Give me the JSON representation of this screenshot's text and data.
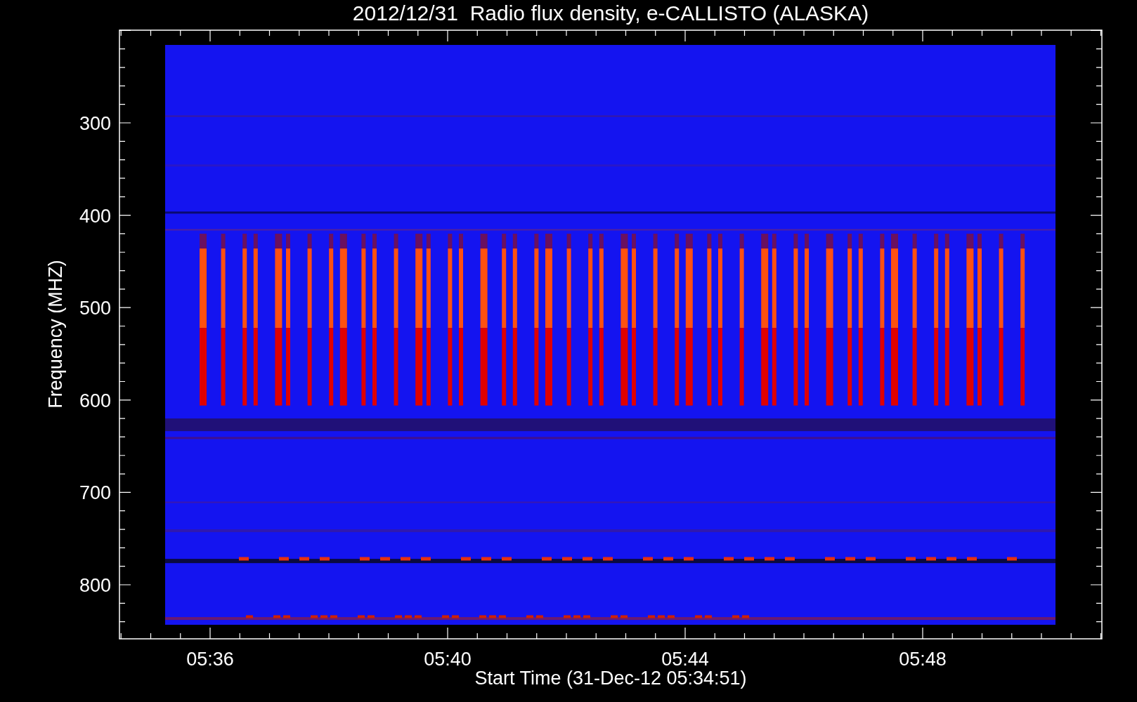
{
  "title": "2012/12/31  Radio flux density, e-CALLISTO (ALASKA)",
  "plot": {
    "ylabel": "Frequency (MHZ)",
    "xlabel": "Start Time (31-Dec-12 05:34:51)",
    "yticks": [
      "300",
      "400",
      "500",
      "600",
      "700",
      "800"
    ],
    "xticks": [
      "05:36",
      "05:40",
      "05:44",
      "05:48"
    ]
  }
}
